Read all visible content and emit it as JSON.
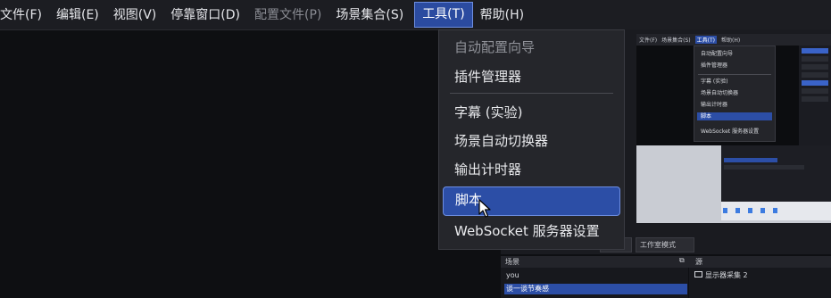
{
  "menubar": {
    "items": [
      {
        "label": "文件(F)",
        "state": "normal"
      },
      {
        "label": "编辑(E)",
        "state": "normal"
      },
      {
        "label": "视图(V)",
        "state": "normal"
      },
      {
        "label": "停靠窗口(D)",
        "state": "normal"
      },
      {
        "label": "配置文件(P)",
        "state": "disabled"
      },
      {
        "label": "场景集合(S)",
        "state": "normal"
      },
      {
        "label": "工具(T)",
        "state": "active"
      },
      {
        "label": "帮助(H)",
        "state": "normal"
      }
    ]
  },
  "tools_menu": {
    "items": [
      {
        "label": "自动配置向导",
        "state": "disabled"
      },
      {
        "label": "插件管理器",
        "state": "normal"
      },
      {
        "label": "字幕 (实验)",
        "state": "normal"
      },
      {
        "label": "场景自动切换器",
        "state": "normal"
      },
      {
        "label": "输出计时器",
        "state": "normal"
      },
      {
        "label": "脚本",
        "state": "selected"
      },
      {
        "label": "WebSocket 服务器设置",
        "state": "normal"
      }
    ]
  },
  "preview": {
    "menu": [
      "文件(F)",
      "场景集合(S)",
      "工具(T)",
      "帮助(H)"
    ],
    "dropdown": [
      "自动配置向导",
      "插件管理器",
      "字幕 (实验)",
      "场景自动切换器",
      "输出计时器",
      "脚本",
      "WebSocket 服务器设置"
    ]
  },
  "dock": {
    "scenes_header": "场景",
    "sources_header": "源",
    "scenes": [
      {
        "label": "you",
        "selected": false
      },
      {
        "label": "谈一谈节奏感",
        "selected": true
      }
    ],
    "sources": [
      "显示器采集 2"
    ],
    "button_label": "工作室模式"
  },
  "colors": {
    "accent": "#2c4ea6",
    "accent_border": "#6d8ee2",
    "menubar_bg": "#1c1d22",
    "dropdown_bg": "#25262b"
  }
}
